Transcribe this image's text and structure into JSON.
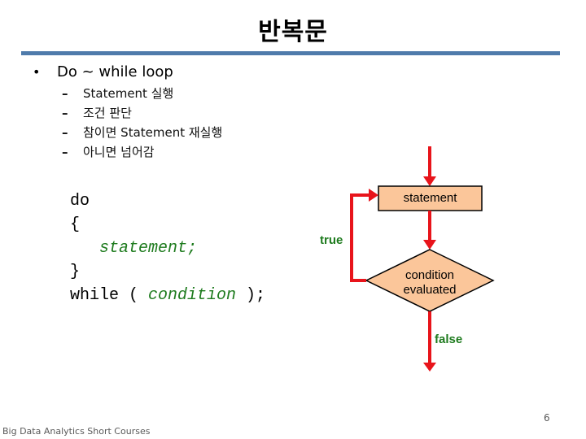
{
  "slide": {
    "title": "반복문",
    "accent_color": "#4F7BAB",
    "bullet": {
      "symbol": "•",
      "text": "Do ~ while loop"
    },
    "sub_items": [
      {
        "dash": "–",
        "text": "Statement 실행"
      },
      {
        "dash": "–",
        "text": "조건 판단"
      },
      {
        "dash": "–",
        "text": "참이면 Statement 재실행"
      },
      {
        "dash": "–",
        "text": "아니면 넘어감"
      }
    ],
    "code": {
      "line1": "do",
      "line2": "{",
      "line3_indent": "   ",
      "line3": "statement;",
      "line4": "}",
      "line5_prefix": "while ( ",
      "line5_cond": "condition",
      "line5_suffix": " );"
    },
    "flowchart": {
      "statement_node": "statement",
      "condition_node_line1": "condition",
      "condition_node_line2": "evaluated",
      "true_label": "true",
      "false_label": "false",
      "colors": {
        "arrow": "#E8141B",
        "node_fill": "#FBC69A",
        "label": "#1E7B1E"
      }
    },
    "footer": {
      "course": "Big Data Analytics Short Courses",
      "page_number": "6"
    }
  }
}
